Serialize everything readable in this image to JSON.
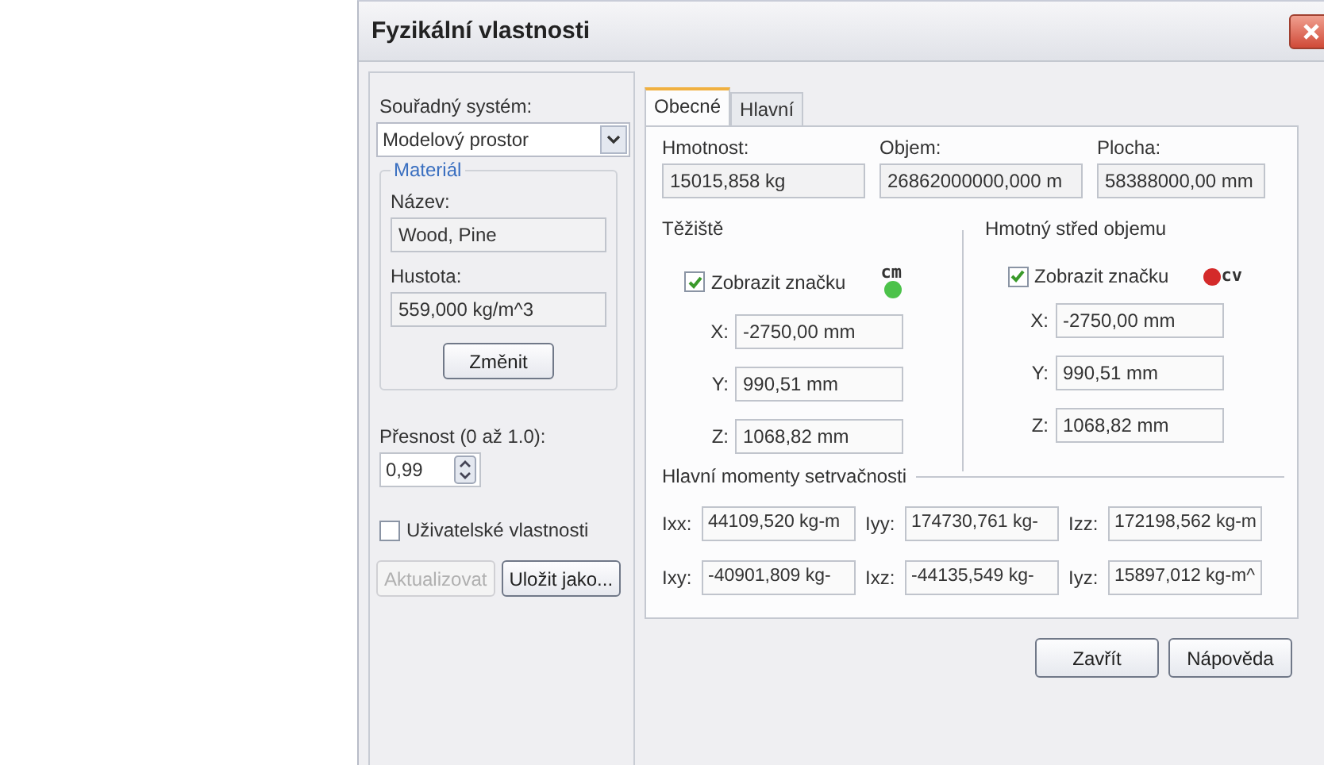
{
  "window": {
    "title": "Fyzikální vlastnosti"
  },
  "left": {
    "coordinate_system": {
      "label": "Souřadný systém:",
      "value": "Modelový prostor"
    },
    "material": {
      "title": "Materiál",
      "name_label": "Název:",
      "name_value": "Wood, Pine",
      "density_label": "Hustota:",
      "density_value": "559,000 kg/m^3",
      "change_button": "Změnit"
    },
    "precision": {
      "label": "Přesnost (0 až 1.0):",
      "value": "0,99"
    },
    "user_properties": {
      "label": "Uživatelské vlastnosti",
      "checked": false
    },
    "buttons": [
      {
        "label": "Aktualizovat",
        "disabled": true
      },
      {
        "label": "Uložit jako...",
        "disabled": false
      }
    ]
  },
  "tabs": [
    {
      "label": "Obecné",
      "selected": true
    },
    {
      "label": "Hlavní",
      "selected": false
    }
  ],
  "general": {
    "fields": [
      {
        "label": "Hmotnost:",
        "value": "15015,858 kg"
      },
      {
        "label": "Objem:",
        "value": "26862000000,000 m"
      },
      {
        "label": "Plocha:",
        "value": "58388000,00 mm"
      }
    ],
    "groups": [
      {
        "title": "Těžiště",
        "show_marker": {
          "label": "Zobrazit značku",
          "checked": true
        },
        "marker": {
          "label": "cm",
          "color": "#4cc24a",
          "kind": "above"
        },
        "coords": [
          {
            "axis": "X:",
            "value": "-2750,00 mm"
          },
          {
            "axis": "Y:",
            "value": "990,51 mm"
          },
          {
            "axis": "Z:",
            "value": "1068,82 mm"
          }
        ]
      },
      {
        "title": "Hmotný střed objemu",
        "show_marker": {
          "label": "Zobrazit značku",
          "checked": true
        },
        "marker": {
          "label": "cv",
          "color": "#d42a2a",
          "kind": "superscript"
        },
        "coords": [
          {
            "axis": "X:",
            "value": "-2750,00 mm"
          },
          {
            "axis": "Y:",
            "value": "990,51 mm"
          },
          {
            "axis": "Z:",
            "value": "1068,82 mm"
          }
        ]
      }
    ],
    "moments": {
      "title": "Hlavní momenty setrvačnosti",
      "rows": [
        [
          {
            "label": "Ixx:",
            "value": "44109,520 kg-m"
          },
          {
            "label": "Iyy:",
            "value": "174730,761 kg-"
          },
          {
            "label": "Izz:",
            "value": "172198,562 kg-m"
          }
        ],
        [
          {
            "label": "Ixy:",
            "value": "-40901,809 kg-"
          },
          {
            "label": "Ixz:",
            "value": "-44135,549 kg-"
          },
          {
            "label": "Iyz:",
            "value": "15897,012 kg-m^"
          }
        ]
      ]
    }
  },
  "footer_buttons": [
    "Zavřít",
    "Nápověda"
  ]
}
